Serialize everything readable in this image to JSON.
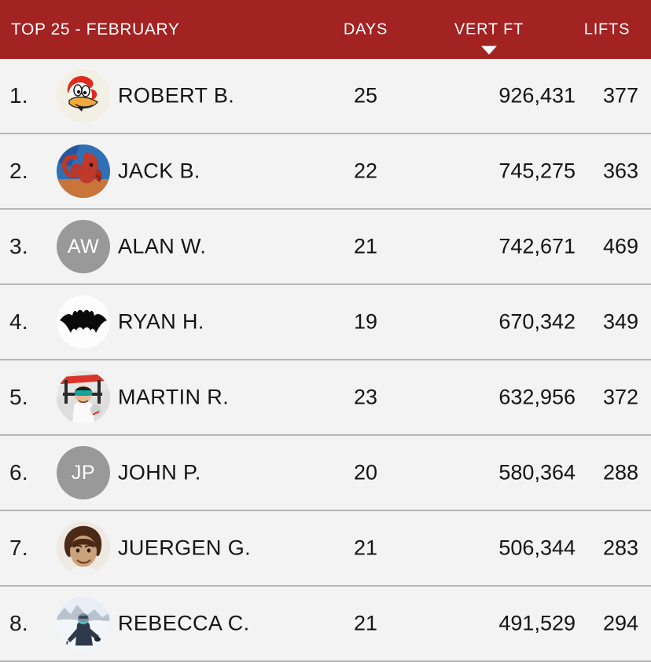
{
  "header": {
    "title": "TOP 25 - FEBRUARY",
    "columns": {
      "days": "DAYS",
      "vert": "VERT FT",
      "lifts": "LIFTS"
    },
    "sort_indicator": "caret-down-icon",
    "bar_color": "#a32222",
    "text_color": "#ffffff"
  },
  "theme": {
    "row_bg": "#f4f3f3",
    "divider": "#b6b6b6",
    "text": "#141414",
    "initials_bg": "#999999"
  },
  "rows": [
    {
      "rank": "1.",
      "name": "ROBERT B.",
      "days": "25",
      "vert": "926,431",
      "lifts": "377",
      "avatar_kind": "photo",
      "avatar_name": "avatar-woody-woodpecker"
    },
    {
      "rank": "2.",
      "name": "JACK B.",
      "days": "22",
      "vert": "745,275",
      "lifts": "363",
      "avatar_kind": "photo",
      "avatar_name": "avatar-ram-painting"
    },
    {
      "rank": "3.",
      "name": "ALAN W.",
      "days": "21",
      "vert": "742,671",
      "lifts": "469",
      "avatar_kind": "initials",
      "avatar_initials": "AW",
      "avatar_name": "avatar-initials-aw"
    },
    {
      "rank": "4.",
      "name": "RYAN H.",
      "days": "19",
      "vert": "670,342",
      "lifts": "349",
      "avatar_kind": "photo",
      "avatar_name": "avatar-batman-logo"
    },
    {
      "rank": "5.",
      "name": "MARTIN R.",
      "days": "23",
      "vert": "632,956",
      "lifts": "372",
      "avatar_kind": "photo",
      "avatar_name": "avatar-skier-chairlift"
    },
    {
      "rank": "6.",
      "name": "JOHN P.",
      "days": "20",
      "vert": "580,364",
      "lifts": "288",
      "avatar_kind": "initials",
      "avatar_initials": "JP",
      "avatar_name": "avatar-initials-jp"
    },
    {
      "rank": "7.",
      "name": "JUERGEN G.",
      "days": "21",
      "vert": "506,344",
      "lifts": "283",
      "avatar_kind": "photo",
      "avatar_name": "avatar-portrait-curly-hair"
    },
    {
      "rank": "8.",
      "name": "REBECCA C.",
      "days": "21",
      "vert": "491,529",
      "lifts": "294",
      "avatar_kind": "photo",
      "avatar_name": "avatar-snowboarder-mountain"
    }
  ]
}
